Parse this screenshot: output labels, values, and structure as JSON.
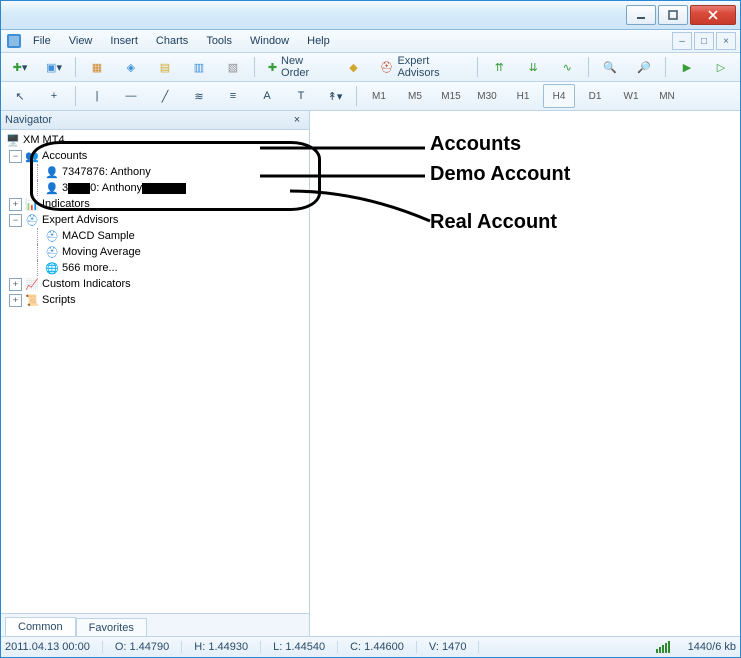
{
  "menu": {
    "items": [
      "File",
      "View",
      "Insert",
      "Charts",
      "Tools",
      "Window",
      "Help"
    ]
  },
  "toolbar1": {
    "new_order": "New Order",
    "expert_advisors": "Expert Advisors"
  },
  "toolbar2": {
    "letter_a": "A",
    "letter_t": "T",
    "timeframes": [
      "M1",
      "M5",
      "M15",
      "M30",
      "H1",
      "H4",
      "D1",
      "W1",
      "MN"
    ],
    "active_tf": "H4"
  },
  "navigator": {
    "title": "Navigator",
    "root": "XM MT4",
    "nodes": {
      "accounts_label": "Accounts",
      "account1": "7347876: Anthony",
      "account2_prefix": "3",
      "account2_mid": "0: Anthony",
      "indicators_label": "Indicators",
      "ea_label": "Expert Advisors",
      "ea_children": [
        "MACD Sample",
        "Moving Average",
        "566 more..."
      ],
      "custom_label": "Custom Indicators",
      "scripts_label": "Scripts"
    },
    "tabs": {
      "common": "Common",
      "favorites": "Favorites"
    }
  },
  "annotations": {
    "accounts": "Accounts",
    "demo": "Demo Account",
    "real": "Real Account"
  },
  "status": {
    "datetime": "2011.04.13 00:00",
    "o": "O: 1.44790",
    "h": "H: 1.44930",
    "l": "L: 1.44540",
    "c": "C: 1.44600",
    "v": "V: 1470",
    "net": "1440/6 kb"
  }
}
